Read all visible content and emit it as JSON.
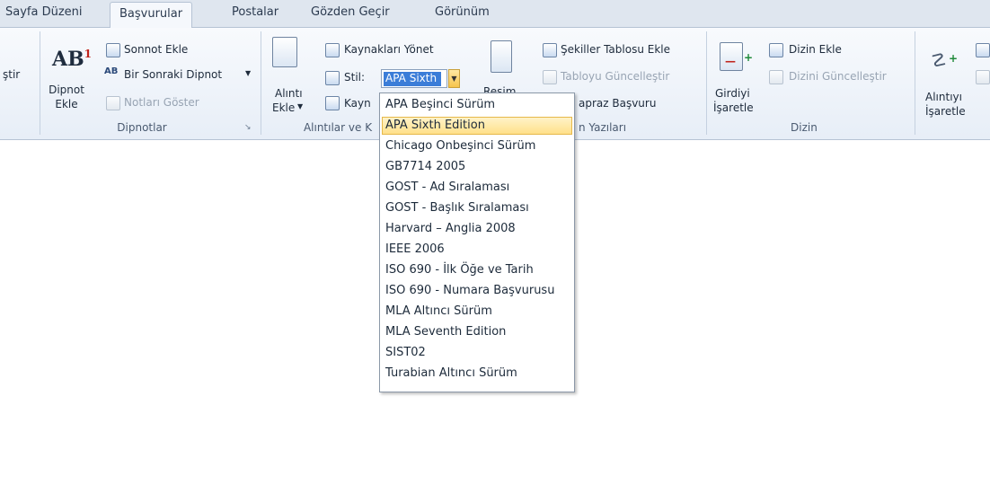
{
  "tabs": [
    "Sayfa Düzeni",
    "Başvurular",
    "Postalar",
    "Gözden Geçir",
    "Görünüm"
  ],
  "ribbon": {
    "left_partial": "ştir",
    "footnotes": {
      "insert_footnote": [
        "Dipnot",
        "Ekle"
      ],
      "insert_endnote": "Sonnot Ekle",
      "next_footnote": "Bir Sonraki Dipnot",
      "show_notes": "Notları Göster",
      "group_label": "Dipnotlar"
    },
    "citations": {
      "insert_citation": [
        "Alıntı",
        "Ekle"
      ],
      "manage_sources": "Kaynakları Yönet",
      "style_label": "Stil:",
      "style_value": "APA Sixth",
      "bibliography_partial": "Kayn",
      "group_label_partial": "Alıntılar ve K"
    },
    "captions": {
      "insert_caption_partial": "Resim",
      "insert_table_of_figures": "Şekiller Tablosu Ekle",
      "update_table": "Tabloyu Güncelleştir",
      "cross_reference_partial": "apraz Başvuru",
      "group_label_partial": "n Yazıları"
    },
    "index": {
      "mark_entry": [
        "Girdiyi",
        "İşaretle"
      ],
      "insert_index": "Dizin Ekle",
      "update_index": "Dizini Güncelleştir",
      "group_label": "Dizin"
    },
    "table_of_authorities": {
      "mark_citation": [
        "Alıntıyı",
        "İşaretle"
      ]
    }
  },
  "style_dropdown": {
    "selected": "APA Sixth Edition",
    "items": [
      "APA Beşinci Sürüm",
      "APA Sixth Edition",
      "Chicago Onbeşinci Sürüm",
      "GB7714 2005",
      "GOST - Ad Sıralaması",
      "GOST - Başlık Sıralaması",
      "Harvard – Anglia 2008",
      "IEEE 2006",
      "ISO 690 - İlk Öğe ve Tarih",
      "ISO 690 - Numara Başvurusu",
      "MLA Altıncı Sürüm",
      "MLA Seventh Edition",
      "SIST02",
      "Turabian Altıncı Sürüm"
    ]
  },
  "colors": {
    "accent_highlight": "#ffe08a",
    "selection_blue": "#3b7dd8",
    "ribbon_bg": "#e7eef7"
  }
}
